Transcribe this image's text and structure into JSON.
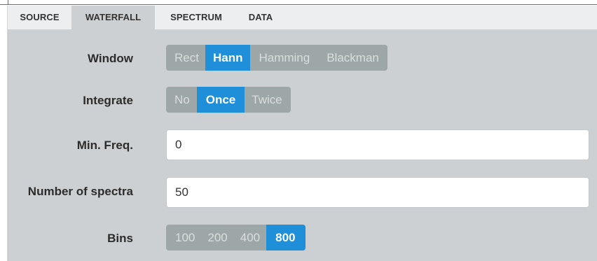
{
  "tabs": [
    {
      "label": "SOURCE",
      "active": false
    },
    {
      "label": "WATERFALL",
      "active": true
    },
    {
      "label": "SPECTRUM",
      "active": false
    },
    {
      "label": "DATA",
      "active": false
    }
  ],
  "window": {
    "label": "Window",
    "options": [
      "Rect",
      "Hann",
      "Hamming",
      "Blackman"
    ],
    "selected": "Hann"
  },
  "integrate": {
    "label": "Integrate",
    "options": [
      "No",
      "Once",
      "Twice"
    ],
    "selected": "Once"
  },
  "min_freq": {
    "label": "Min. Freq.",
    "value": "0"
  },
  "num_spectra": {
    "label": "Number of spectra",
    "value": "50"
  },
  "bins": {
    "label": "Bins",
    "options": [
      "100",
      "200",
      "400",
      "800"
    ],
    "selected": "800"
  },
  "colors": {
    "panel": "#ccd0d2",
    "tabbar": "#eceeef",
    "segment": "#9ea7a8",
    "selected": "#1e8fd8"
  }
}
